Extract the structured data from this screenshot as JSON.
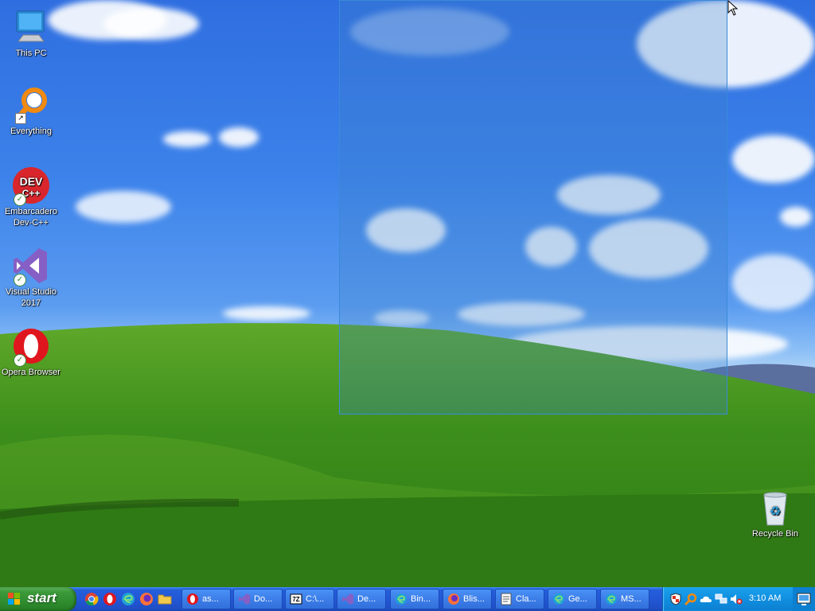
{
  "desktop": {
    "icons": [
      {
        "label": "This PC",
        "icon": "this-pc-icon"
      },
      {
        "label": "Everything",
        "icon": "everything-search-icon"
      },
      {
        "label": "Embarcadero Dev-C++",
        "icon": "dev-cpp-icon",
        "glyph_text": "DEV C++"
      },
      {
        "label": "Visual Studio 2017",
        "icon": "visual-studio-icon"
      },
      {
        "label": "Opera Browser",
        "icon": "opera-icon"
      },
      {
        "label": "Recycle Bin",
        "icon": "recycle-bin-icon"
      }
    ]
  },
  "taskbar": {
    "start_label": "start",
    "quick_launch": [
      "chrome-icon",
      "opera-icon",
      "edge-icon",
      "firefox-icon",
      "folder-icon"
    ],
    "buttons": [
      {
        "label": "as...",
        "icon": "opera-icon"
      },
      {
        "label": "Do...",
        "icon": "visual-studio-icon"
      },
      {
        "label": "C:\\...",
        "icon": "7zip-icon",
        "glyph_text": "7Z"
      },
      {
        "label": "De...",
        "icon": "visual-studio-icon"
      },
      {
        "label": "Bin...",
        "icon": "edge-icon"
      },
      {
        "label": "Blis...",
        "icon": "firefox-icon"
      },
      {
        "label": "Cla...",
        "icon": "document-icon"
      },
      {
        "label": "Ge...",
        "icon": "edge-icon"
      },
      {
        "label": "MS...",
        "icon": "edge-icon"
      }
    ],
    "tray": {
      "icons": [
        "security-shield-icon",
        "search-icon",
        "onedrive-cloud-icon",
        "network-icon",
        "volume-muted-icon"
      ],
      "clock": "3:10 AM"
    }
  },
  "colors": {
    "taskbar_blue": "#245edb",
    "start_green": "#3c9a3a",
    "tray_blue": "#118fe0",
    "selection_border": "#3a8ad8"
  }
}
